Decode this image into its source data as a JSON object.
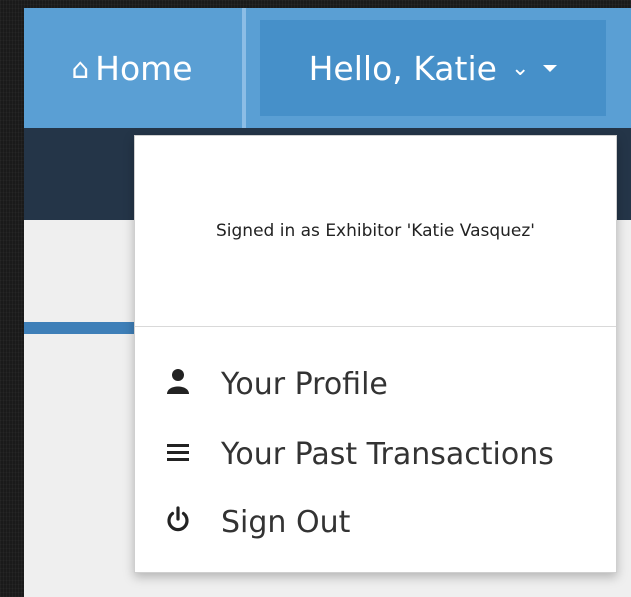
{
  "nav": {
    "home_label": "Home",
    "home_icon": "home-icon",
    "user_label": "Hello, Katie",
    "user_chevron_icon": "chevron-down-icon",
    "user_caret_icon": "caret-down-icon"
  },
  "dropdown": {
    "signed_in_text": "Signed in as Exhibitor 'Katie Vasquez'",
    "items": [
      {
        "label": "Your Profile",
        "icon": "user-icon"
      },
      {
        "label": "Your Past Transactions",
        "icon": "list-icon"
      },
      {
        "label": "Sign Out",
        "icon": "power-icon"
      }
    ]
  },
  "colors": {
    "navbar": "#5a9fd4",
    "toggle_active": "#4690c9",
    "subbar": "#243548",
    "page_bg": "#efefef"
  }
}
